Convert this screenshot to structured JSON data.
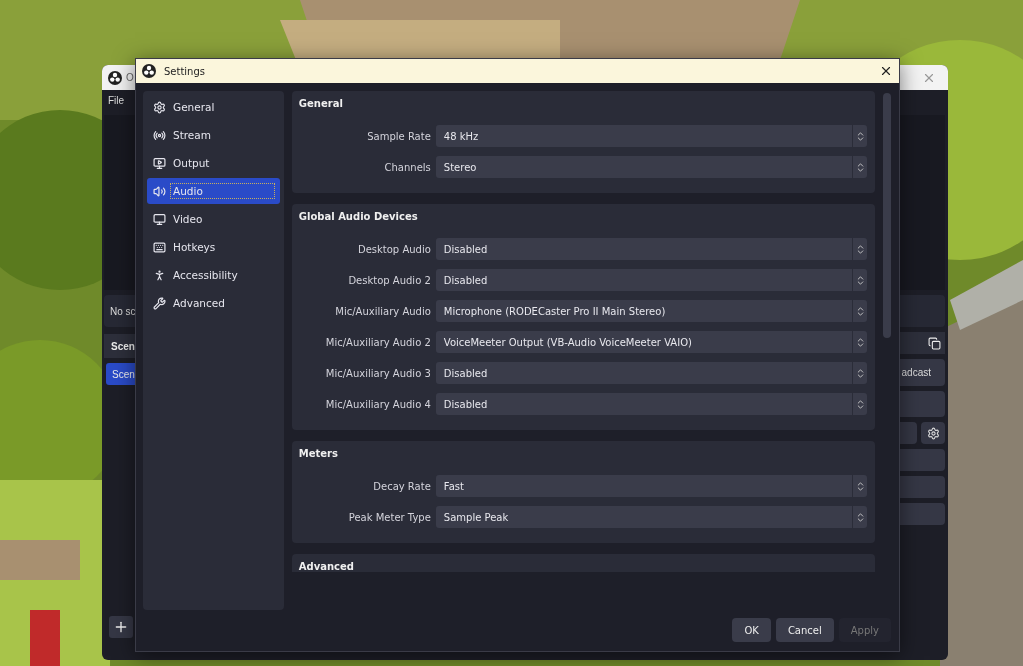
{
  "main_window": {
    "title": "O",
    "menu": [
      "File"
    ],
    "sources_hint": "No sc",
    "scenes_header": "Scen",
    "scenes": [
      {
        "label": "Scen",
        "selected": true
      }
    ],
    "controls": [
      "adcast"
    ]
  },
  "settings": {
    "title": "Settings",
    "sidebar": [
      {
        "label": "General",
        "selected": false
      },
      {
        "label": "Stream",
        "selected": false
      },
      {
        "label": "Output",
        "selected": false
      },
      {
        "label": "Audio",
        "selected": true
      },
      {
        "label": "Video",
        "selected": false
      },
      {
        "label": "Hotkeys",
        "selected": false
      },
      {
        "label": "Accessibility",
        "selected": false
      },
      {
        "label": "Advanced",
        "selected": false
      }
    ],
    "groups": [
      {
        "title": "General",
        "rows": [
          {
            "label": "Sample Rate",
            "value": "48 kHz"
          },
          {
            "label": "Channels",
            "value": "Stereo"
          }
        ]
      },
      {
        "title": "Global Audio Devices",
        "rows": [
          {
            "label": "Desktop Audio",
            "value": "Disabled"
          },
          {
            "label": "Desktop Audio 2",
            "value": "Disabled"
          },
          {
            "label": "Mic/Auxiliary Audio",
            "value": "Microphone (RODECaster Pro II Main Stereo)"
          },
          {
            "label": "Mic/Auxiliary Audio 2",
            "value": "VoiceMeeter Output (VB-Audio VoiceMeeter VAIO)"
          },
          {
            "label": "Mic/Auxiliary Audio 3",
            "value": "Disabled"
          },
          {
            "label": "Mic/Auxiliary Audio 4",
            "value": "Disabled"
          }
        ]
      },
      {
        "title": "Meters",
        "rows": [
          {
            "label": "Decay Rate",
            "value": "Fast"
          },
          {
            "label": "Peak Meter Type",
            "value": "Sample Peak"
          }
        ]
      },
      {
        "title": "Advanced"
      }
    ],
    "buttons": [
      {
        "label": "OK",
        "disabled": false
      },
      {
        "label": "Cancel",
        "disabled": false
      },
      {
        "label": "Apply",
        "disabled": true
      }
    ]
  }
}
